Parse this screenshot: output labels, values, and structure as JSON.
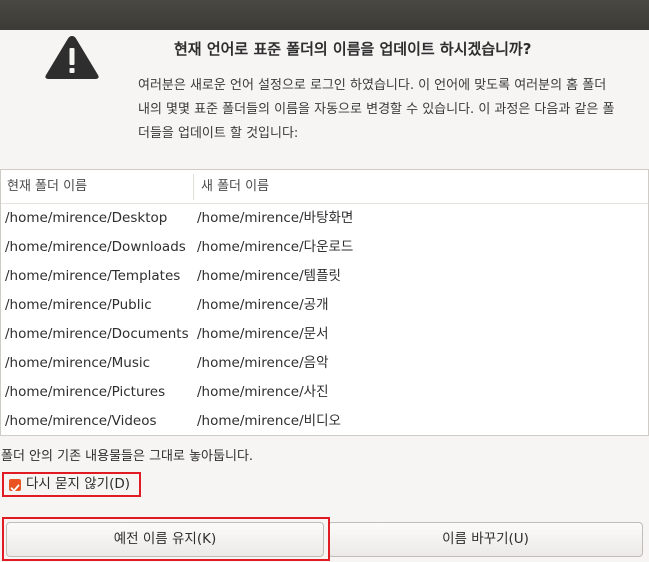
{
  "dialog": {
    "heading": "현재 언어로 표준 폴더의 이름을 업데이트 하시겠습니까?",
    "description": "여러분은 새로운 언어 설정으로 로그인 하였습니다. 이 언어에 맞도록 여러분의 홈 폴더 내의 몇몇 표준 폴더들의 이름을 자동으로 변경할 수 있습니다. 이 과정은 다음과 같은 폴더들을 업데이트 할 것입니다:",
    "icon": "warning-icon",
    "accent_color": "#e95420",
    "highlight_color": "#e01b24"
  },
  "table": {
    "headers": {
      "current": "현재 폴더 이름",
      "new": "새 폴더 이름"
    },
    "rows": [
      {
        "old": "/home/mirence/Desktop",
        "new": "/home/mirence/바탕화면"
      },
      {
        "old": "/home/mirence/Downloads",
        "new": "/home/mirence/다운로드"
      },
      {
        "old": "/home/mirence/Templates",
        "new": "/home/mirence/템플릿"
      },
      {
        "old": "/home/mirence/Public",
        "new": "/home/mirence/공개"
      },
      {
        "old": "/home/mirence/Documents",
        "new": "/home/mirence/문서"
      },
      {
        "old": "/home/mirence/Music",
        "new": "/home/mirence/음악"
      },
      {
        "old": "/home/mirence/Pictures",
        "new": "/home/mirence/사진"
      },
      {
        "old": "/home/mirence/Videos",
        "new": "/home/mirence/비디오"
      }
    ]
  },
  "note": "폴더 안의 기존 내용물들은 그대로 놓아둡니다.",
  "checkbox": {
    "label": "다시 묻지 않기(D)",
    "checked": true
  },
  "buttons": {
    "keep": "예전 이름 유지(K)",
    "rename": "이름 바꾸기(U)"
  }
}
